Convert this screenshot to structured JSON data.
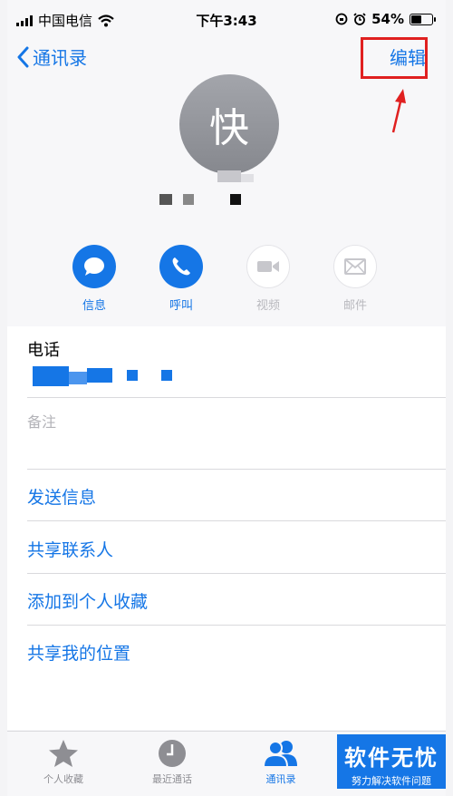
{
  "status_bar": {
    "carrier": "中国电信",
    "time": "下午3:43",
    "battery_percent": "54%",
    "battery_level": 0.54
  },
  "nav": {
    "back_label": "通讯录",
    "edit_label": "编辑"
  },
  "contact": {
    "avatar_initial": "快"
  },
  "actions": [
    {
      "label": "信息",
      "icon": "message-bubble-icon",
      "enabled": true
    },
    {
      "label": "呼叫",
      "icon": "phone-icon",
      "enabled": true
    },
    {
      "label": "视频",
      "icon": "video-camera-icon",
      "enabled": false
    },
    {
      "label": "邮件",
      "icon": "mail-icon",
      "enabled": false
    }
  ],
  "details": {
    "phone_label": "电话",
    "note_label": "备注"
  },
  "links": {
    "send_message": "发送信息",
    "share_contact": "共享联系人",
    "add_favorite": "添加到个人收藏",
    "share_location": "共享我的位置"
  },
  "tabbar": {
    "favorites": "个人收藏",
    "recents": "最近通话",
    "contacts": "通讯录"
  },
  "watermark": {
    "main": "软件无忧",
    "sub": "努力解决软件问题"
  },
  "colors": {
    "accent": "#1576e6",
    "highlight": "#e02020"
  }
}
